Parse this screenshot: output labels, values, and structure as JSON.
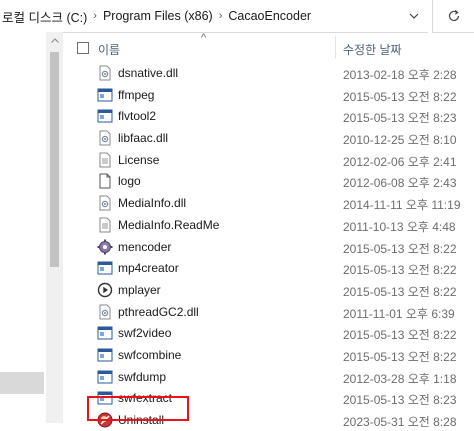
{
  "address": {
    "crumbs": [
      "로컬 디스크 (C:)",
      "Program Files (x86)",
      "CacaoEncoder"
    ],
    "separator": "›"
  },
  "header": {
    "name_label": "이름",
    "date_label": "수정한 날짜",
    "sort_arrow": "^"
  },
  "files": [
    {
      "name": "dsnative.dll",
      "date": "2013-02-18 오후 2:28",
      "icon": "dll-icon"
    },
    {
      "name": "ffmpeg",
      "date": "2015-05-13 오전 8:22",
      "icon": "exe-icon"
    },
    {
      "name": "flvtool2",
      "date": "2015-05-13 오전 8:23",
      "icon": "exe-icon"
    },
    {
      "name": "libfaac.dll",
      "date": "2010-12-25 오전 8:10",
      "icon": "dll-icon"
    },
    {
      "name": "License",
      "date": "2012-02-06 오후 2:41",
      "icon": "text-file-icon"
    },
    {
      "name": "logo",
      "date": "2012-06-08 오후 2:43",
      "icon": "image-file-icon"
    },
    {
      "name": "MediaInfo.dll",
      "date": "2014-11-11 오후 11:19",
      "icon": "dll-icon"
    },
    {
      "name": "MediaInfo.ReadMe",
      "date": "2011-10-13 오후 4:48",
      "icon": "text-file-icon"
    },
    {
      "name": "mencoder",
      "date": "2015-05-13 오전 8:22",
      "icon": "gear-icon"
    },
    {
      "name": "mp4creator",
      "date": "2015-05-13 오전 8:22",
      "icon": "exe-icon"
    },
    {
      "name": "mplayer",
      "date": "2015-05-13 오전 8:22",
      "icon": "play-icon"
    },
    {
      "name": "pthreadGC2.dll",
      "date": "2011-11-01 오후 6:39",
      "icon": "dll-icon"
    },
    {
      "name": "swf2video",
      "date": "2015-05-13 오전 8:22",
      "icon": "exe-icon"
    },
    {
      "name": "swfcombine",
      "date": "2015-05-13 오전 8:22",
      "icon": "exe-icon"
    },
    {
      "name": "swfdump",
      "date": "2012-03-28 오후 1:18",
      "icon": "exe-icon"
    },
    {
      "name": "swfextract",
      "date": "2015-05-13 오전 8:23",
      "icon": "exe-icon"
    },
    {
      "name": "Uninstall",
      "date": "2023-05-31 오전 8:28",
      "icon": "uninstall-icon"
    }
  ],
  "colors": {
    "highlight": "#e8141a",
    "date_text": "#6d6d6d",
    "header_text": "#4c607a"
  }
}
